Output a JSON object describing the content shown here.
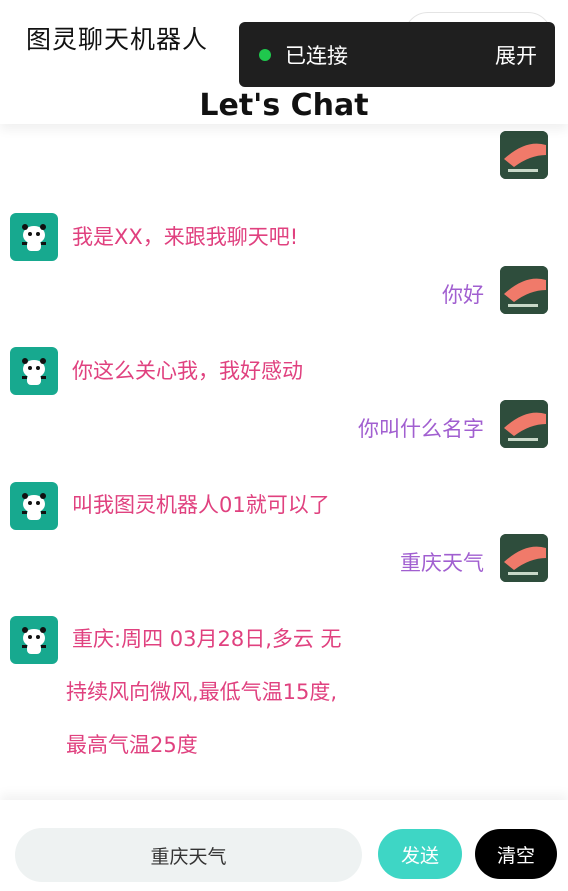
{
  "header": {
    "app_title": "图灵聊天机器人",
    "page_title": "Let's Chat",
    "capsule_more": "•••"
  },
  "connection": {
    "status_text": "已连接",
    "expand_label": "展开",
    "status_color": "#1fc84d"
  },
  "messages": [
    {
      "from": "user",
      "text": ""
    },
    {
      "from": "bot",
      "text": "我是XX，来跟我聊天吧!"
    },
    {
      "from": "user",
      "text": "你好"
    },
    {
      "from": "bot",
      "text": "你这么关心我，我好感动"
    },
    {
      "from": "user",
      "text": "你叫什么名字"
    },
    {
      "from": "bot",
      "text": "叫我图灵机器人01就可以了"
    },
    {
      "from": "user",
      "text": "重庆天气"
    },
    {
      "from": "bot",
      "lines": [
        "重庆:周四 03月28日,多云 无",
        "持续风向微风,最低气温15度,",
        "最高气温25度"
      ]
    }
  ],
  "composer": {
    "input_value": "重庆天气",
    "send_label": "发送",
    "clear_label": "清空"
  },
  "colors": {
    "bot_text": "#e0417f",
    "user_text": "#a15fd0",
    "send_button": "#3ed6c5",
    "clear_button": "#000000",
    "bot_avatar": "#17a98f"
  },
  "icons": {
    "bot_avatar": "panda-icon",
    "user_avatar": "user-avatar-image"
  }
}
